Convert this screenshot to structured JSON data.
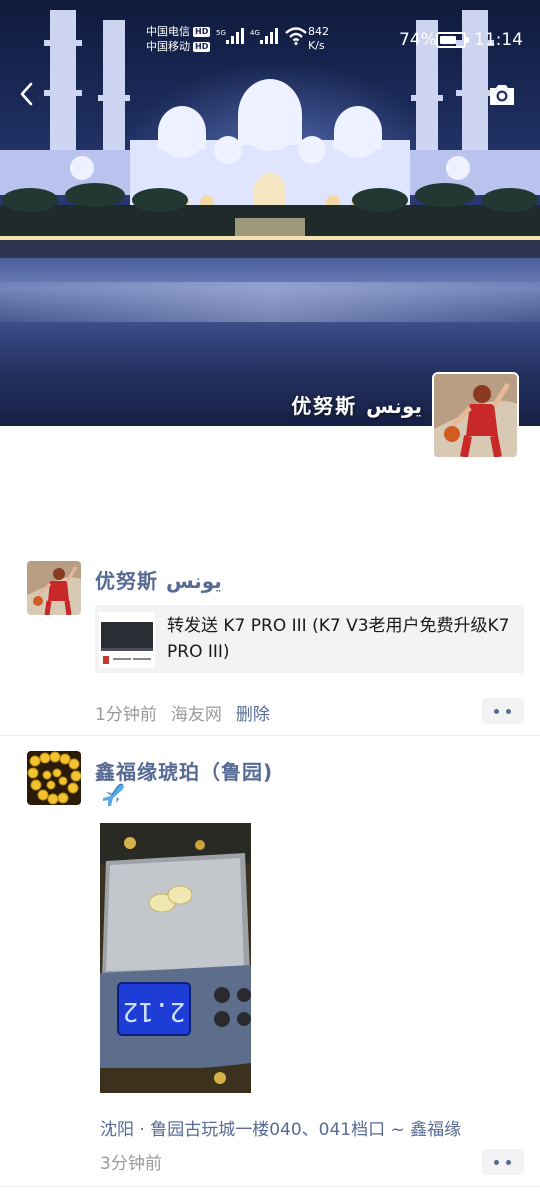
{
  "status_bar": {
    "carrier1": "中国电信",
    "carrier2": "中国移动",
    "hd": "HD",
    "net1": "5G",
    "net2": "4G",
    "speed_value": "842",
    "speed_unit": "K/s",
    "battery": "74%",
    "battery_level": 0.74,
    "time": "11:14"
  },
  "header": {
    "back_icon": "chevron-left-icon",
    "camera_icon": "camera-icon"
  },
  "cover": {
    "owner_name": "优努斯 يونس"
  },
  "posts": [
    {
      "author": "优努斯 يونس",
      "share": {
        "text": "转发送 K7 PRO III (K7 V3老用户免费升级K7 PRO III)"
      },
      "time": "1分钟前",
      "source": "海友网",
      "delete": "删除"
    },
    {
      "author": "鑫福缘琥珀（鲁园)",
      "emoji": "airplane-emoji",
      "photo": {
        "scale_display": "2.12"
      },
      "location": "沈阳 · 鲁园古玩城一楼040、041档口 ~ 鑫福缘",
      "time": "3分钟前"
    }
  ],
  "colors": {
    "link": "#576b95",
    "meta": "#9a9a9a",
    "card_bg": "#f3f3f5"
  }
}
